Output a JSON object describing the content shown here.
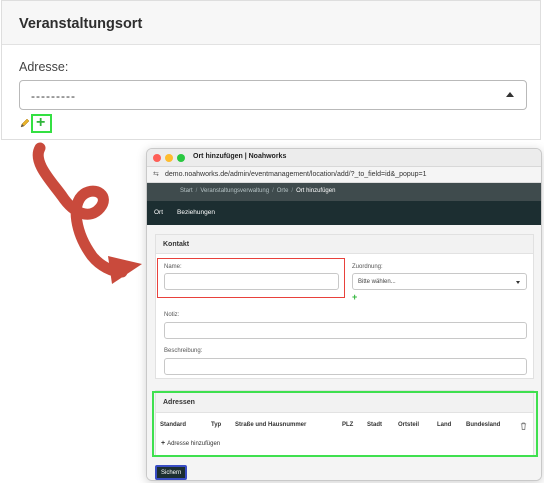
{
  "panel": {
    "heading": "Veranstaltungsort",
    "field_label": "Adresse:",
    "select_value": "---------",
    "add_icon": "+"
  },
  "popup": {
    "window_title": "Ort hinzufügen | Noahworks",
    "url": "demo.noahworks.de/admin/eventmanagement/location/add/?_to_field=id&_popup=1",
    "breadcrumbs": [
      "Start",
      "Veranstaltungsverwaltung",
      "Orte",
      "Ort hinzufügen"
    ],
    "breadcrumb_separator": "/",
    "tabs": [
      "Ort",
      "Beziehungen"
    ],
    "kontakt": {
      "heading": "Kontakt",
      "name_label": "Name:",
      "zuordnung_label": "Zuordnung:",
      "zuordnung_value": "Bitte wählen...",
      "add_icon": "+",
      "notiz_label": "Notiz:",
      "beschreibung_label": "Beschreibung:"
    },
    "adressen": {
      "heading": "Adressen",
      "columns": [
        "Standard",
        "Typ",
        "Straße und Hausnummer",
        "PLZ",
        "Stadt",
        "Ortsteil",
        "Land",
        "Bundesland"
      ],
      "add_row_label": "Adresse hinzufügen",
      "add_row_icon": "+",
      "delete_icon": "trash-icon"
    },
    "save_label": "Sichern"
  },
  "colors": {
    "annotation_red": "#e8413b",
    "annotation_green": "#3fe04f",
    "arrow": "#c94a3c",
    "admin_header": "#1c2e31",
    "breadcrumb_bar": "#3f4b4d",
    "add_green": "#2fb53a",
    "save_button_border": "#3a4ec5"
  }
}
